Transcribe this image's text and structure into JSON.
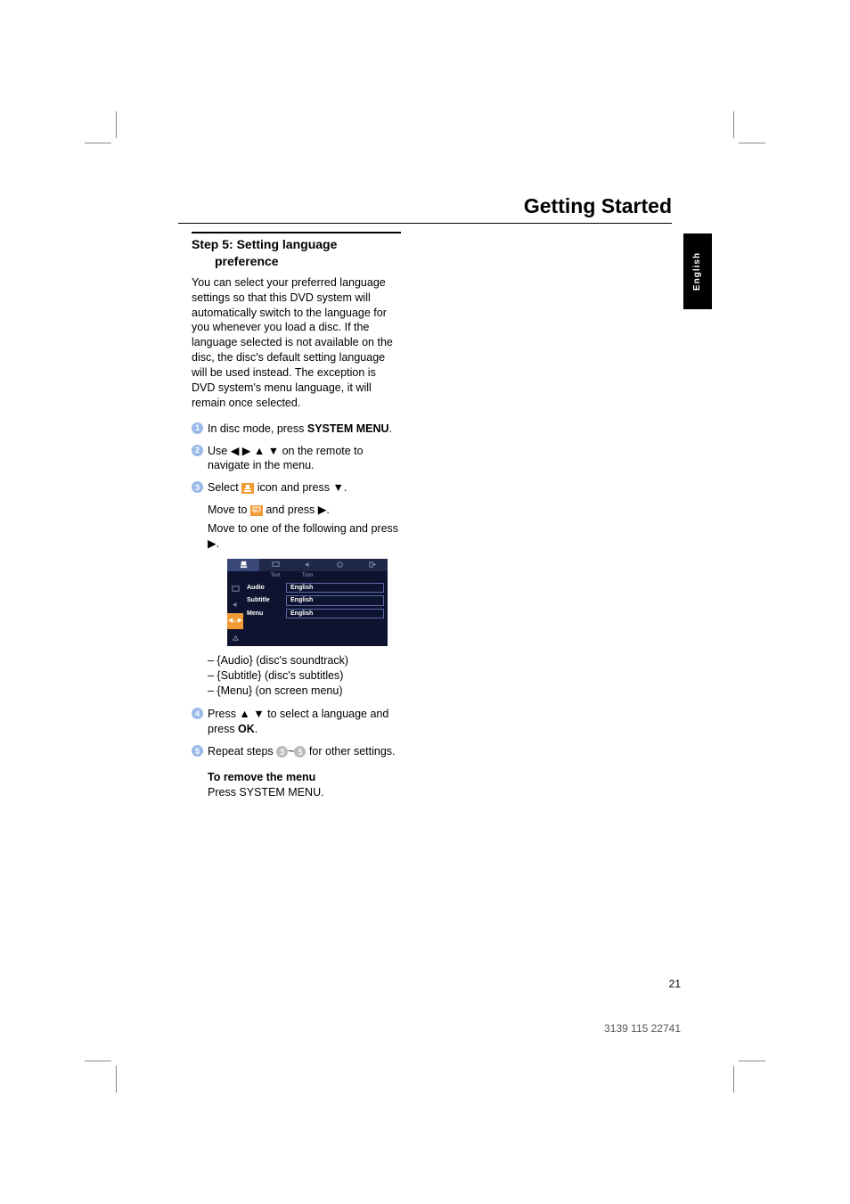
{
  "header": {
    "title": "Getting Started"
  },
  "langTab": "English",
  "step": {
    "number": "Step 5:",
    "title": "Setting language preference",
    "intro": "You can select your preferred language settings so that this DVD system will automatically switch to the language for you whenever you load a disc.  If the language selected is not available on the disc, the disc's default setting language will be used instead.  The exception is DVD system's menu language, it will remain once selected."
  },
  "items": {
    "i1a": "In disc mode, press ",
    "i1b": "SYSTEM MENU",
    "i1c": ".",
    "i2a": "Use ◀ ▶ ▲ ▼ on the remote to navigate in the menu.",
    "i3a": "Select ",
    "i3b": " icon and press ▼.",
    "i3c": "Move to ",
    "i3d": " and press ▶.",
    "i3e": "Move to one of the following and press ▶.",
    "i4a": "Press ▲ ▼ to select a language and press ",
    "i4b": "OK",
    "i4c": ".",
    "i5a": "Repeat steps ",
    "i5b": "~",
    "i5c": " for other settings."
  },
  "dashList": {
    "d1": "– {Audio} (disc's soundtrack)",
    "d2": "– {Subtitle} (disc's subtitles)",
    "d3": "– {Menu} (on screen menu)"
  },
  "removeMenu": {
    "title": "To remove the menu",
    "text": "Press SYSTEM MENU."
  },
  "menuSub": {
    "text": "Text",
    "toon": "Toon"
  },
  "menuRows": {
    "audio": {
      "label": "Audio",
      "value": "English"
    },
    "subtitle": {
      "label": "Subtitle",
      "value": "English"
    },
    "menu": {
      "label": "Menu",
      "value": "English"
    }
  },
  "footer": {
    "page": "21",
    "code": "3139 115 22741"
  }
}
